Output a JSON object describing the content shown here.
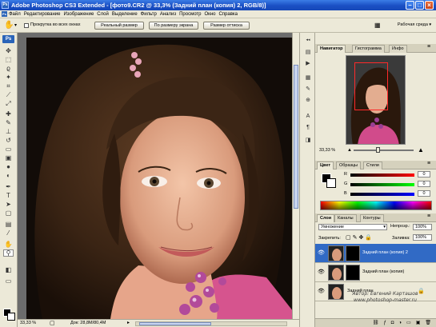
{
  "window": {
    "title": "Adobe Photoshop CS3 Extended - [фото9.CR2 @ 33,3% (Задний план (копия) 2, RGB/8)]",
    "app_icon": "Ps",
    "controls": [
      "minimize-icon",
      "maximize-icon",
      "close-icon"
    ]
  },
  "menu": {
    "items": [
      "Файл",
      "Редактирование",
      "Изображение",
      "Слой",
      "Выделение",
      "Фильтр",
      "Анализ",
      "Просмотр",
      "Окно",
      "Справка"
    ]
  },
  "options": {
    "scroll_all_label": "Прокрутка во всех окнах",
    "btn_actual": "Реальный размер",
    "btn_fit": "По размеру экрана",
    "btn_print": "Размер оттиска",
    "workspace_label": "Рабочая среда"
  },
  "toolbox": {
    "logo": "Ps",
    "tools": [
      "move-tool",
      "marquee-tool",
      "lasso-tool",
      "magic-wand-tool",
      "crop-tool",
      "slice-tool",
      "healing-tool",
      "brush-tool",
      "stamp-tool",
      "history-brush-tool",
      "eraser-tool",
      "gradient-tool",
      "blur-tool",
      "dodge-tool",
      "pen-tool",
      "type-tool",
      "path-select-tool",
      "shape-tool",
      "notes-tool",
      "eyedropper-tool",
      "hand-tool",
      "zoom-tool"
    ]
  },
  "document": {
    "zoom": "33,33 %",
    "doc_size": "Док: 28,8M/80,4M"
  },
  "navigator": {
    "tabs": [
      "Навигатор",
      "Гистограмма",
      "Инфо"
    ],
    "zoom": "33,33 %"
  },
  "color": {
    "tabs": [
      "Цвет",
      "Образцы",
      "Стили"
    ],
    "channels": [
      {
        "label": "R",
        "value": "0"
      },
      {
        "label": "G",
        "value": "0"
      },
      {
        "label": "B",
        "value": "0"
      }
    ]
  },
  "layers": {
    "tabs": [
      "Слои",
      "Каналы",
      "Контуры"
    ],
    "blend_mode": "Умножение",
    "opacity_label": "Непрозр.:",
    "opacity": "100%",
    "lock_label": "Закрепить:",
    "fill_label": "Заливка:",
    "fill": "100%",
    "items": [
      {
        "name": "Задний план (копия) 2",
        "active": true
      },
      {
        "name": "Задний план (копия)",
        "active": false
      },
      {
        "name": "Задний план",
        "active": false
      }
    ]
  },
  "watermark": {
    "author": "Автор: Евгений Карташов",
    "site": "www.photoshop-master.ru"
  },
  "colors": {
    "title_blue": "#1a4fc4",
    "panel_bg": "#ece9d8",
    "selection": "#316ac5"
  }
}
